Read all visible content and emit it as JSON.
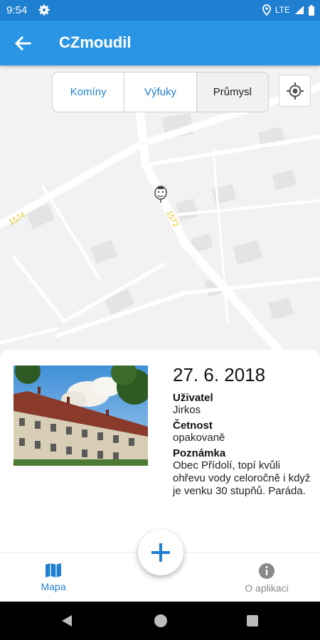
{
  "status_bar": {
    "time": "9:54",
    "network": "LTE"
  },
  "app_bar": {
    "title": "CZmoudil"
  },
  "map": {
    "filters": [
      {
        "label": "Komíny",
        "active": false
      },
      {
        "label": "Výfuky",
        "active": false
      },
      {
        "label": "Průmysl",
        "active": true
      }
    ],
    "road_labels": [
      "1574",
      "1572"
    ]
  },
  "report": {
    "date": "27. 6. 2018",
    "user_label": "Uživatel",
    "user_value": "Jirkos",
    "frequency_label": "Četnost",
    "frequency_value": "opakovaně",
    "note_label": "Poznámka",
    "note_value": "Obec Přídolí, topí kvůli ohřevu vody celoročně i když je venku 30 stupňů. Paráda."
  },
  "bottom_nav": {
    "items": [
      {
        "label": "Mapa",
        "icon": "map-icon",
        "active": true
      },
      {
        "label": "O aplikaci",
        "icon": "info-icon",
        "active": false
      }
    ]
  },
  "fab": {
    "icon": "plus-icon"
  },
  "colors": {
    "primary": "#2b95e5",
    "primary_dark": "#1f7fd0",
    "accent": "#1f7fd0"
  }
}
